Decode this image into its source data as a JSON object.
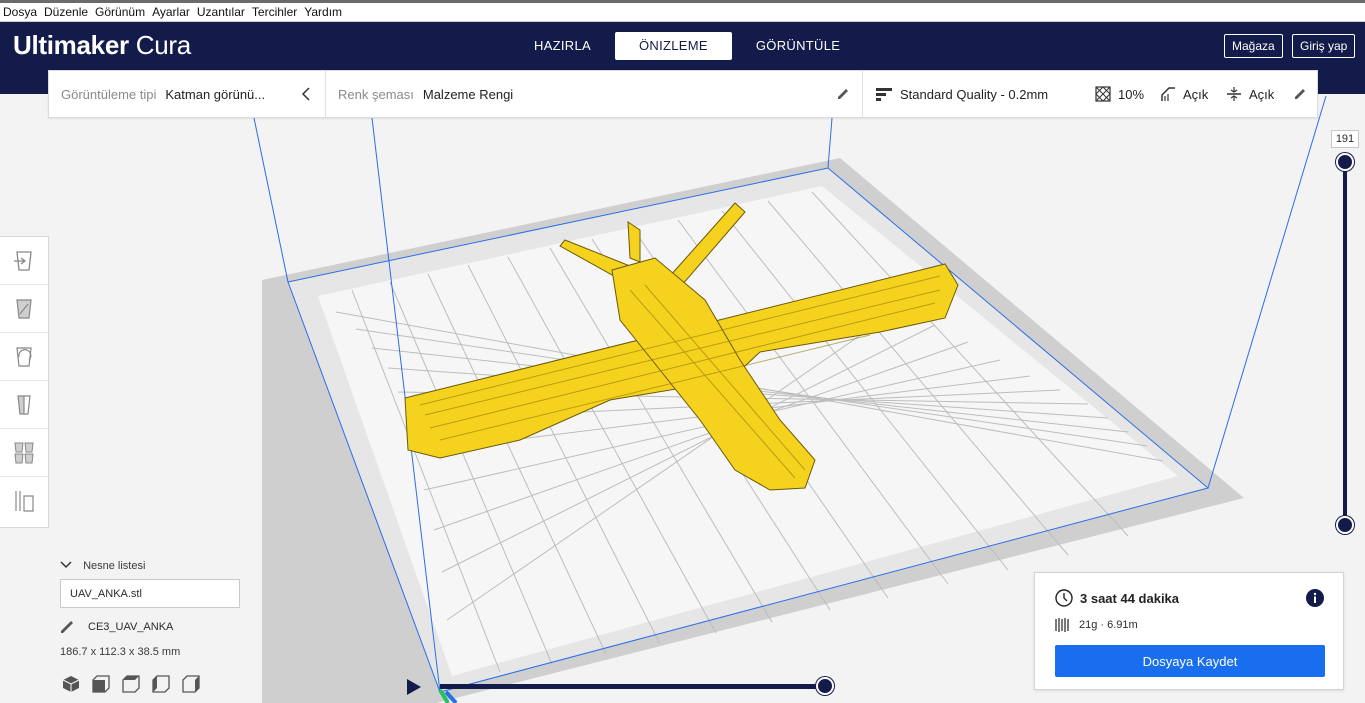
{
  "menu": [
    "Dosya",
    "Düzenle",
    "Görünüm",
    "Ayarlar",
    "Uzantılar",
    "Tercihler",
    "Yardım"
  ],
  "app": {
    "brand_bold": "Ultimaker",
    "brand_light": "Cura"
  },
  "stages": [
    {
      "label": "HAZIRLA",
      "active": false
    },
    {
      "label": "ÖNIZLEME",
      "active": true
    },
    {
      "label": "GÖRÜNTÜLE",
      "active": false
    }
  ],
  "header_buttons": {
    "marketplace": "Mağaza",
    "signin": "Giriş yap"
  },
  "view_settings": {
    "view_type_label": "Görüntüleme tipi",
    "view_type_value": "Katman görünü...",
    "color_scheme_label": "Renk şeması",
    "color_scheme_value": "Malzeme Rengi"
  },
  "print_settings": {
    "profile": "Standard Quality - 0.2mm",
    "infill": "10%",
    "support": "Açık",
    "adhesion": "Açık"
  },
  "object_list": {
    "header": "Nesne listesi",
    "filename": "UAV_ANKA.stl",
    "job_name": "CE3_UAV_ANKA",
    "dimensions": "186.7 x 112.3 x 38.5 mm"
  },
  "layer_slider": {
    "current_layer": "191"
  },
  "print_info": {
    "time": "3 saat 44 dakika",
    "material": "21g · 6.91m",
    "save_button": "Dosyaya Kaydet"
  },
  "colors": {
    "header_bg": "#131b4a",
    "accent_blue": "#196ef0",
    "model_yellow": "#f5d21e"
  }
}
